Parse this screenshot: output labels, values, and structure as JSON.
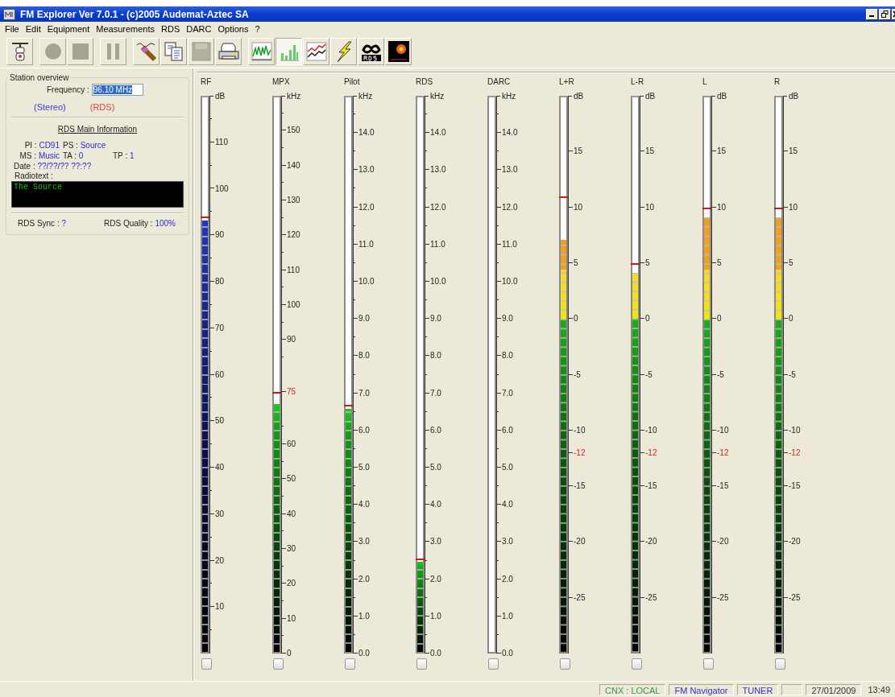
{
  "window": {
    "title": "FM Explorer Ver 7.0.1 - (c)2005 Audemat-Aztec SA"
  },
  "menu": [
    {
      "label": "File"
    },
    {
      "label": "Edit"
    },
    {
      "label": "Equipment"
    },
    {
      "label": "Measurements"
    },
    {
      "label": "RDS"
    },
    {
      "label": "DARC"
    },
    {
      "label": "Options"
    },
    {
      "label": "?"
    }
  ],
  "toolbar": [
    [
      {
        "kind": "tuner",
        "disabled": false,
        "selected": false
      }
    ],
    [
      {
        "kind": "record",
        "disabled": true,
        "selected": false
      },
      {
        "kind": "stop",
        "disabled": true,
        "selected": false
      }
    ],
    [
      {
        "kind": "pause",
        "disabled": true,
        "selected": false
      }
    ],
    [
      {
        "kind": "probe",
        "disabled": false,
        "selected": false
      },
      {
        "kind": "copy",
        "disabled": false,
        "selected": false
      },
      {
        "kind": "save",
        "disabled": true,
        "selected": false
      },
      {
        "kind": "print",
        "disabled": false,
        "selected": false
      }
    ],
    [
      {
        "kind": "spectrum",
        "disabled": false,
        "selected": false
      },
      {
        "kind": "bars",
        "disabled": false,
        "selected": true
      },
      {
        "kind": "graph",
        "disabled": false,
        "selected": false
      },
      {
        "kind": "flash",
        "disabled": false,
        "selected": false
      },
      {
        "kind": "rds",
        "disabled": false,
        "selected": false
      },
      {
        "kind": "darc",
        "disabled": false,
        "selected": false
      }
    ]
  ],
  "station_overview": {
    "title": "Station overview",
    "frequency": {
      "label": "Frequency :",
      "value": "96.10 MHz"
    },
    "indicators": [
      {
        "label": "(Stereo)",
        "color": "#3c3cd8"
      },
      {
        "label": "(RDS)",
        "color": "#e03c3c"
      }
    ],
    "rds_title": "RDS Main Information",
    "rows": [
      [
        {
          "label": "PI :",
          "value": "CD91"
        },
        {
          "label": "PS :",
          "value": "Source"
        }
      ],
      [
        {
          "label": "MS :",
          "value": "Music"
        },
        {
          "label": "TA :",
          "value": "0"
        },
        {
          "label": "TP :",
          "value": "1"
        }
      ],
      [
        {
          "label": "Date :",
          "value": "??/??/?? ??:??"
        }
      ]
    ],
    "radiotext": {
      "label": "Radiotext :",
      "value": "The Source"
    },
    "sync": {
      "label": "RDS Sync :",
      "value": "?"
    },
    "quality": {
      "label": "RDS Quality :",
      "value": "100%"
    }
  },
  "meters": [
    {
      "label": "RF",
      "kind": "rf",
      "unit": "dB",
      "ticks": [
        "110",
        "100",
        "90",
        "80",
        "70",
        "60",
        "50",
        "40",
        "30",
        "20",
        "10"
      ],
      "level": 0.778,
      "peak": {
        "level": 0.784
      },
      "checked": false
    },
    {
      "label": "MPX",
      "kind": "mpx",
      "unit": "kHz",
      "ticks": [
        "150",
        "140",
        "130",
        "120",
        "110",
        "100",
        "90",
        "60",
        "50",
        "40",
        "30",
        "20",
        "10",
        "0"
      ],
      "limit_tick": "75",
      "level": 0.447,
      "peak": {
        "level": 0.467
      },
      "checked": false
    },
    {
      "label": "Pilot",
      "kind": "khz",
      "unit": "kHz",
      "ticks": [
        "14.0",
        "13.0",
        "12.0",
        "11.0",
        "10.0",
        "9.0",
        "8.0",
        "7.0",
        "6.0",
        "5.0",
        "4.0",
        "3.0",
        "2.0",
        "1.0",
        "0.0"
      ],
      "level": 0.439,
      "peak": {
        "level": 0.444
      },
      "checked": false
    },
    {
      "label": "RDS",
      "kind": "khz",
      "unit": "kHz",
      "ticks": [
        "14.0",
        "13.0",
        "12.0",
        "11.0",
        "10.0",
        "9.0",
        "8.0",
        "7.0",
        "6.0",
        "5.0",
        "4.0",
        "3.0",
        "2.0",
        "1.0",
        "0.0"
      ],
      "level": 0.162,
      "peak": {
        "level": 0.167
      },
      "checked": false
    },
    {
      "label": "DARC",
      "kind": "khz",
      "unit": "kHz",
      "ticks": [
        "14.0",
        "13.0",
        "12.0",
        "11.0",
        "10.0",
        "9.0",
        "8.0",
        "7.0",
        "6.0",
        "5.0",
        "4.0",
        "3.0",
        "2.0",
        "1.0",
        "0.0"
      ],
      "checked": false
    },
    {
      "label": "L+R",
      "kind": "db",
      "unit": "dB",
      "ticks": [
        "15",
        "10",
        "5",
        "0",
        "-5",
        "-10",
        "-15",
        "-20",
        "-25"
      ],
      "limit_tick": "-12",
      "level": 0.743,
      "peak": {
        "level": 0.82
      },
      "checked": false
    },
    {
      "label": "L-R",
      "kind": "db",
      "unit": "dB",
      "ticks": [
        "15",
        "10",
        "5",
        "0",
        "-5",
        "-10",
        "-15",
        "-20",
        "-25"
      ],
      "limit_tick": "-12",
      "level": 0.683,
      "peak": {
        "level": 0.7
      },
      "checked": false
    },
    {
      "label": "L",
      "kind": "db",
      "unit": "dB",
      "ticks": [
        "15",
        "10",
        "5",
        "0",
        "-5",
        "-10",
        "-15",
        "-20",
        "-25"
      ],
      "limit_tick": "-12",
      "level": 0.784,
      "peak": {
        "level": 0.8
      },
      "checked": false
    },
    {
      "label": "R",
      "kind": "db",
      "unit": "dB",
      "ticks": [
        "15",
        "10",
        "5",
        "0",
        "-5",
        "-10",
        "-15",
        "-20",
        "-25"
      ],
      "limit_tick": "-12",
      "level": 0.784,
      "peak": {
        "level": 0.8
      },
      "checked": false
    }
  ],
  "status_bar": [
    {
      "text": "CNX : LOCAL",
      "kind": "panel",
      "color": "#2f9e3a"
    },
    {
      "text": "FM Navigator",
      "kind": "panel",
      "color": "#3434b8"
    },
    {
      "text": "TUNER",
      "kind": "panel",
      "color": "#3434b8"
    },
    {
      "text": "27/01/2009",
      "kind": "panel"
    },
    {
      "text": "13:49",
      "kind": "plain"
    }
  ]
}
